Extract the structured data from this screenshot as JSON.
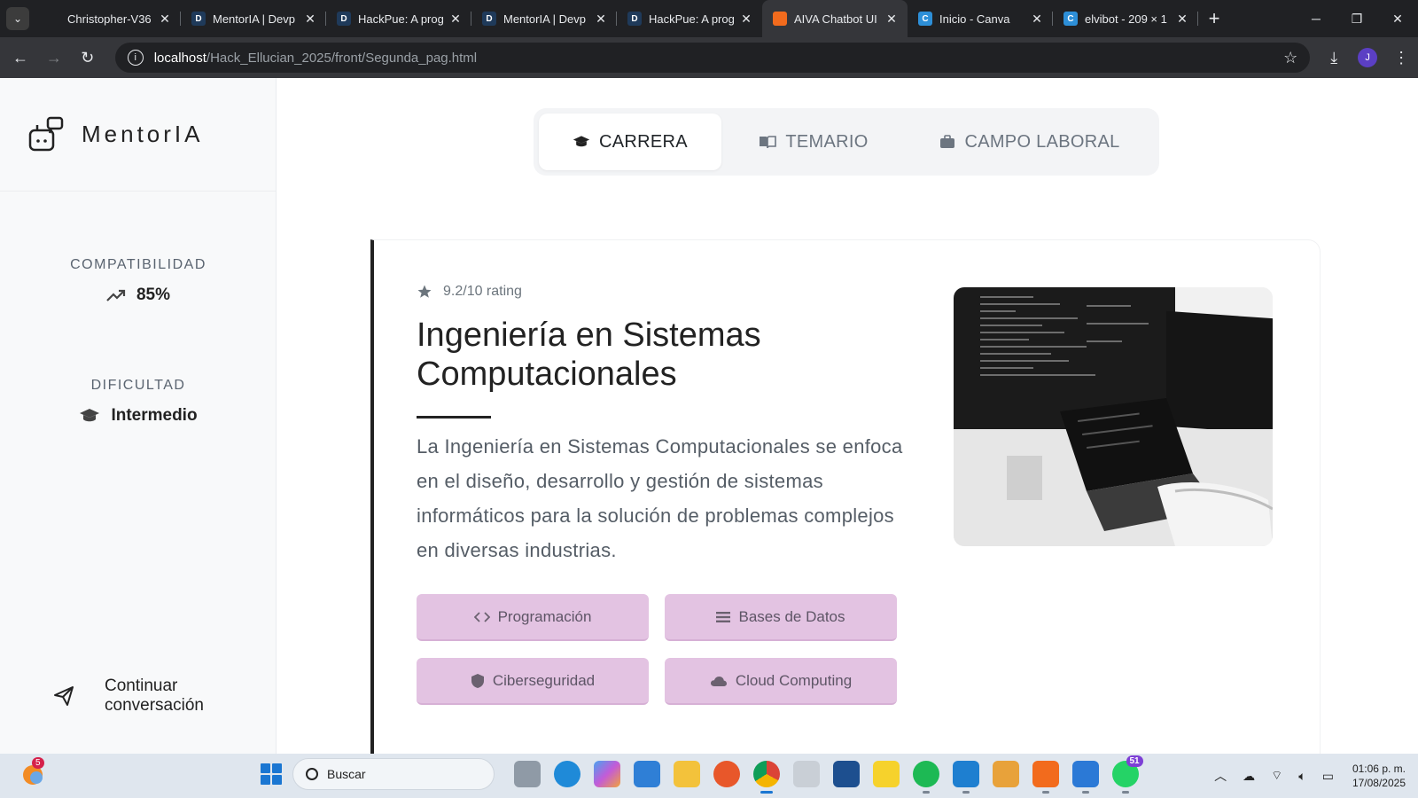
{
  "browser": {
    "tabs": [
      {
        "title": "Christopher-V36",
        "fav_color": "#202124",
        "fav_text": "",
        "icon": "github-icon"
      },
      {
        "title": "MentorIA | Devp",
        "fav_color": "#1f3a5a",
        "fav_text": "D",
        "icon": "devpost-icon"
      },
      {
        "title": "HackPue: A prog",
        "fav_color": "#1f3a5a",
        "fav_text": "D",
        "icon": "devpost-icon"
      },
      {
        "title": "MentorIA | Devp",
        "fav_color": "#1f3a5a",
        "fav_text": "D",
        "icon": "devpost-icon"
      },
      {
        "title": "HackPue: A prog",
        "fav_color": "#1f3a5a",
        "fav_text": "D",
        "icon": "devpost-icon"
      },
      {
        "title": "AIVA Chatbot UI",
        "fav_color": "#f26b1d",
        "fav_text": "",
        "icon": "xampp-icon",
        "active": true
      },
      {
        "title": "Inicio - Canva",
        "fav_color": "#2d8fd8",
        "fav_text": "C",
        "icon": "canva-icon"
      },
      {
        "title": "elvibot - 209 × 1",
        "fav_color": "#2d8fd8",
        "fav_text": "C",
        "icon": "canva-icon"
      }
    ],
    "url_host": "localhost",
    "url_path": "/Hack_Ellucian_2025/front/Segunda_pag.html",
    "profile_initial": "J"
  },
  "sidebar": {
    "brand": "MentorIA",
    "compat_label": "COMPATIBILIDAD",
    "compat_value": "85%",
    "difficulty_label": "DIFICULTAD",
    "difficulty_value": "Intermedio",
    "continue_label": "Continuar conversación"
  },
  "tabs": [
    {
      "label": "CARRERA",
      "icon": "graduation-cap-icon",
      "active": true
    },
    {
      "label": "TEMARIO",
      "icon": "book-open-icon",
      "active": false
    },
    {
      "label": "CAMPO LABORAL",
      "icon": "briefcase-icon",
      "active": false
    }
  ],
  "career": {
    "rating": "9.2/10 rating",
    "title": "Ingeniería en Sistemas Computacionales",
    "description": "La Ingeniería en Sistemas Computacionales se enfoca en el diseño, desarrollo y gestión de sistemas informáticos para la solución de problemas complejos en diversas industrias.",
    "chips": [
      {
        "label": "Programación",
        "icon": "code-icon"
      },
      {
        "label": "Bases de Datos",
        "icon": "list-icon"
      },
      {
        "label": "Ciberseguridad",
        "icon": "shield-icon"
      },
      {
        "label": "Cloud Computing",
        "icon": "cloud-icon"
      }
    ]
  },
  "taskbar": {
    "search_placeholder": "Buscar",
    "notif_badge": "5",
    "whatsapp_badge": "51",
    "time": "01:06 p. m.",
    "date": "17/08/2025"
  }
}
